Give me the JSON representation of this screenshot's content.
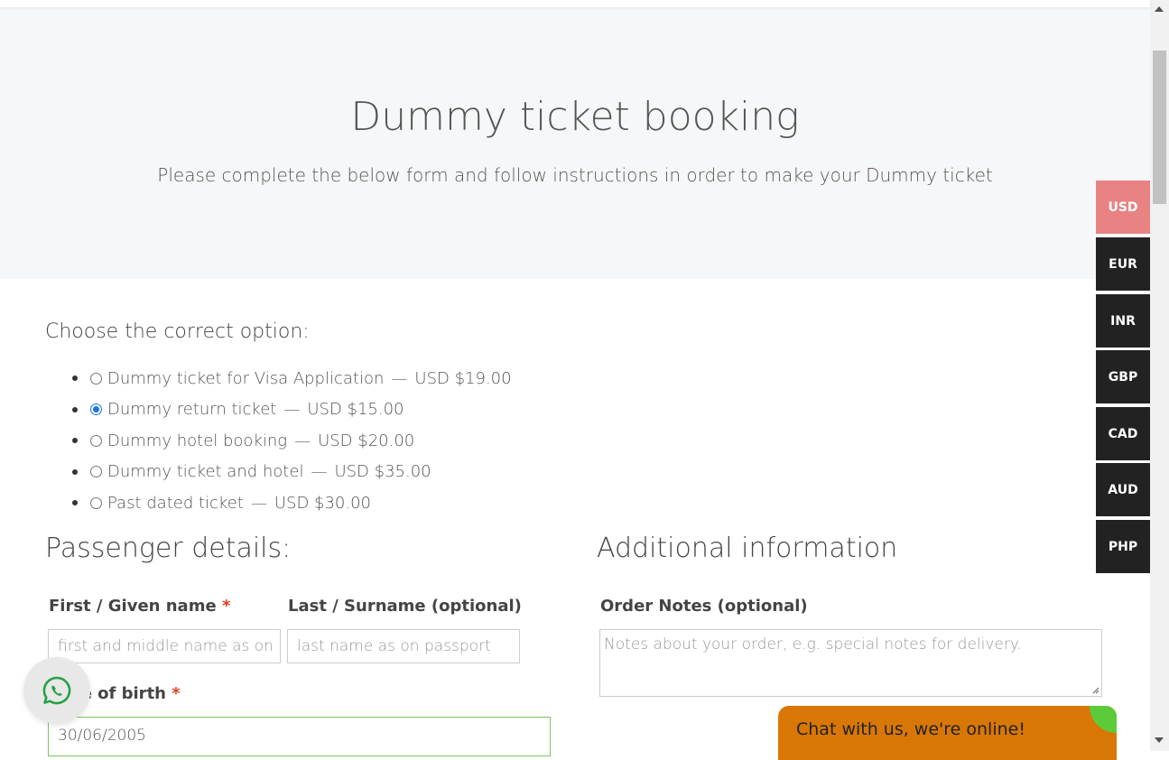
{
  "hero": {
    "title": "Dummy ticket booking",
    "subtitle": "Please complete the below form and follow instructions in order to make your Dummy ticket"
  },
  "options": {
    "heading": "Choose the correct option:",
    "items": [
      {
        "label": "Dummy ticket for Visa Application",
        "price": "USD $19.00",
        "checked": false
      },
      {
        "label": "Dummy return ticket",
        "price": "USD $15.00",
        "checked": true
      },
      {
        "label": "Dummy hotel booking",
        "price": "USD $20.00",
        "checked": false
      },
      {
        "label": "Dummy ticket and hotel",
        "price": "USD $35.00",
        "checked": false
      },
      {
        "label": "Past dated ticket",
        "price": "USD $30.00",
        "checked": false
      }
    ],
    "separator": "—"
  },
  "passenger": {
    "heading": "Passenger details:",
    "first_name_label": "First / Given name",
    "first_name_placeholder": "first and middle name as on passport",
    "last_name_label": "Last / Surname (optional)",
    "last_name_placeholder": "last name as on passport",
    "dob_label": "Date of birth",
    "dob_value": "30/06/2005",
    "required_mark": "*"
  },
  "additional": {
    "heading": "Additional information",
    "notes_label": "Order Notes (optional)",
    "notes_placeholder": "Notes about your order, e.g. special notes for delivery."
  },
  "currencies": {
    "items": [
      "USD",
      "EUR",
      "INR",
      "GBP",
      "CAD",
      "AUD",
      "PHP"
    ],
    "active": "USD",
    "active_color": "#e98383"
  },
  "chat": {
    "label": "Chat with us, we're online!"
  },
  "icons": {
    "whatsapp": "whatsapp-icon"
  }
}
